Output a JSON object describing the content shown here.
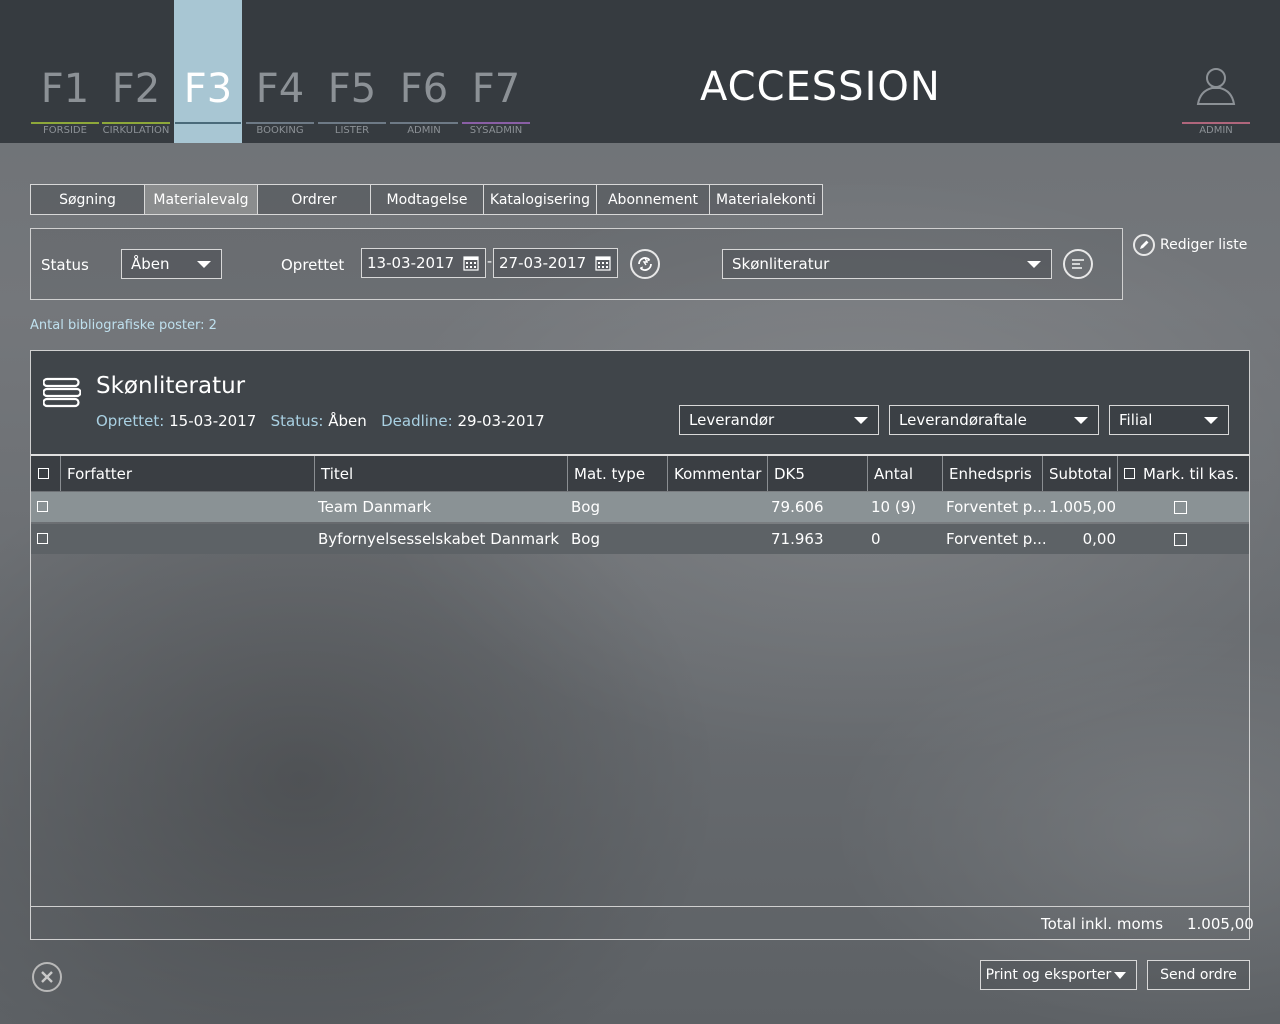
{
  "app_title": "ACCESSION",
  "fkeys": [
    {
      "key": "F1",
      "label": "FORSIDE",
      "color": "#8ea83a"
    },
    {
      "key": "F2",
      "label": "CIRKULATION",
      "color": "#8ea83a"
    },
    {
      "key": "F3",
      "label": "",
      "color": "#4a6a7a"
    },
    {
      "key": "F4",
      "label": "BOOKING",
      "color": "#6e7a86"
    },
    {
      "key": "F5",
      "label": "LISTER",
      "color": "#6e7a86"
    },
    {
      "key": "F6",
      "label": "ADMIN",
      "color": "#6e7a86"
    },
    {
      "key": "F7",
      "label": "SYSADMIN",
      "color": "#8a5fa6"
    }
  ],
  "user": {
    "label": "ADMIN"
  },
  "subtabs": [
    "Søgning",
    "Materialevalg",
    "Ordrer",
    "Modtagelse",
    "Katalogisering",
    "Abonnement",
    "Materialekonti"
  ],
  "active_subtab": "Materialevalg",
  "filter": {
    "status_label": "Status",
    "status_value": "Åben",
    "created_label": "Oprettet",
    "date_from": "13-03-2017",
    "date_sep": "-",
    "date_to": "27-03-2017",
    "list_value": "Skønliteratur"
  },
  "edit_list": "Rediger liste",
  "count_text": "Antal bibliografiske poster: 2",
  "list": {
    "title": "Skønliteratur",
    "created_key": "Oprettet:",
    "created_value": "15-03-2017",
    "status_key": "Status:",
    "status_value": "Åben",
    "deadline_key": "Deadline:",
    "deadline_value": "29-03-2017",
    "dd_supplier": "Leverandør",
    "dd_agreement": "Leverandøraftale",
    "dd_branch": "Filial"
  },
  "columns": [
    "Forfatter",
    "Titel",
    "Mat. type",
    "Kommentar",
    "DK5",
    "Antal",
    "Enhedspris",
    "Subtotal",
    "Mark. til kas."
  ],
  "rows": [
    {
      "author": "",
      "title": "Team Danmark",
      "mattype": "Bog",
      "comment": "",
      "dk5": "79.606",
      "antal": "10 (9)",
      "price": "Forventet p...",
      "subtotal": "1.005,00"
    },
    {
      "author": "",
      "title": "Byfornyelsesselskabet Danmark",
      "mattype": "Bog",
      "comment": "",
      "dk5": "71.963",
      "antal": "0",
      "price": "Forventet p...",
      "subtotal": "0,00"
    }
  ],
  "total_label": "Total inkl. moms",
  "total_value": "1.005,00",
  "buttons": {
    "print": "Print og eksporter",
    "send": "Send ordre"
  }
}
